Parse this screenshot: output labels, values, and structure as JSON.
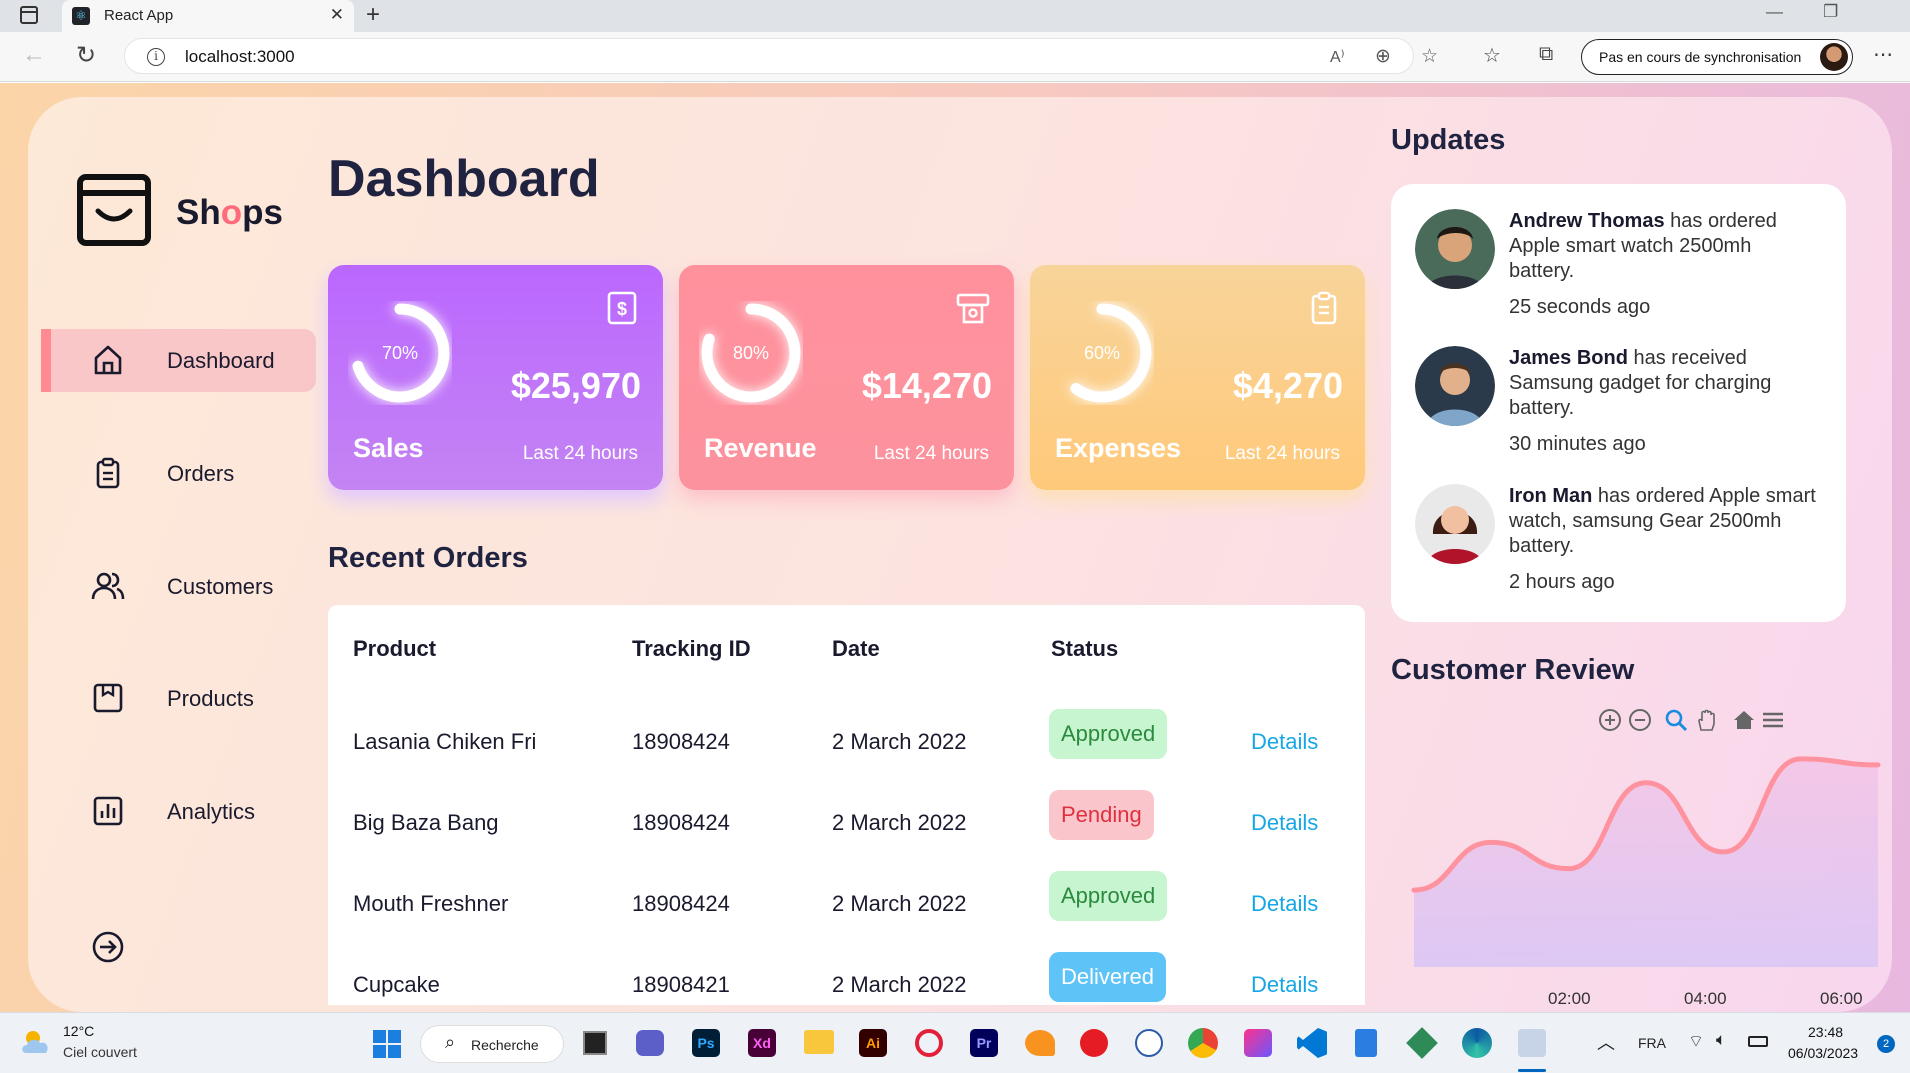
{
  "browser": {
    "tab_title": "React App",
    "url": "localhost:3000",
    "sync_label": "Pas en cours de synchronisation"
  },
  "sidebar": {
    "logo_text": [
      "Sh",
      "o",
      "ps"
    ],
    "items": [
      {
        "label": "Dashboard",
        "icon": "home-icon",
        "active": true
      },
      {
        "label": "Orders",
        "icon": "clipboard-icon"
      },
      {
        "label": "Customers",
        "icon": "users-icon"
      },
      {
        "label": "Products",
        "icon": "package-icon"
      },
      {
        "label": "Analytics",
        "icon": "bar-chart-icon"
      }
    ]
  },
  "main": {
    "title": "Dashboard",
    "cards": [
      {
        "name": "Sales",
        "percent_label": "70%",
        "percent": 0.7,
        "value": "$25,970",
        "period": "Last 24 hours",
        "icon": "dollar-icon"
      },
      {
        "name": "Revenue",
        "percent_label": "80%",
        "percent": 0.8,
        "value": "$14,270",
        "period": "Last 24 hours",
        "icon": "money-icon"
      },
      {
        "name": "Expenses",
        "percent_label": "60%",
        "percent": 0.6,
        "value": "$4,270",
        "period": "Last 24 hours",
        "icon": "clipboard-icon"
      }
    ],
    "recent_orders_title": "Recent Orders",
    "table": {
      "headers": [
        "Product",
        "Tracking ID",
        "Date",
        "Status"
      ],
      "rows": [
        {
          "product": "Lasania Chiken Fri",
          "tracking": "18908424",
          "date": "2 March 2022",
          "status": "Approved",
          "action": "Details"
        },
        {
          "product": "Big Baza Bang",
          "tracking": "18908424",
          "date": "2 March 2022",
          "status": "Pending",
          "action": "Details"
        },
        {
          "product": "Mouth Freshner",
          "tracking": "18908424",
          "date": "2 March 2022",
          "status": "Approved",
          "action": "Details"
        },
        {
          "product": "Cupcake",
          "tracking": "18908421",
          "date": "2 March 2022",
          "status": "Delivered",
          "action": "Details"
        }
      ]
    }
  },
  "right": {
    "updates_title": "Updates",
    "updates": [
      {
        "name": "Andrew Thomas",
        "text": " has ordered Apple smart watch 2500mh battery.",
        "time": "25 seconds ago"
      },
      {
        "name": "James Bond",
        "text": " has received Samsung gadget for charging battery.",
        "time": "30 minutes ago"
      },
      {
        "name": "Iron Man",
        "text": " has ordered Apple smart watch, samsung Gear 2500mh battery.",
        "time": "2 hours ago"
      }
    ],
    "review_title": "Customer Review"
  },
  "chart_data": {
    "type": "area",
    "title": "Customer Review",
    "x_ticks": [
      "02:00",
      "04:00",
      "06:00"
    ],
    "series": [
      {
        "values": [
          10,
          50,
          28,
          100,
          42,
          120,
          115
        ]
      }
    ],
    "colors": {
      "line": "#ff929f",
      "fill_top": "#f8c8e8",
      "fill_bottom": "#d9c4f5"
    },
    "toolbar": [
      "zoom-in-icon",
      "zoom-out-icon",
      "magnifier-icon",
      "pan-hand-icon",
      "home-icon",
      "menu-icon"
    ]
  },
  "taskbar": {
    "temp": "12°C",
    "weather": "Ciel couvert",
    "search_label": "Recherche",
    "lang": "FRA",
    "time": "23:48",
    "date": "06/03/2023",
    "notif_count": "2"
  }
}
